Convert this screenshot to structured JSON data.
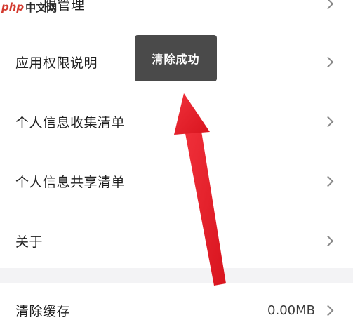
{
  "watermark": {
    "php": "php",
    "cn": "中文网"
  },
  "rows": [
    {
      "label": "限管理",
      "value": ""
    },
    {
      "label": "应用权限说明",
      "value": ""
    },
    {
      "label": "个人信息收集清单",
      "value": ""
    },
    {
      "label": "个人信息共享清单",
      "value": ""
    },
    {
      "label": "关于",
      "value": ""
    }
  ],
  "cache_row": {
    "label": "清除缓存",
    "value": "0.00MB"
  },
  "toast": {
    "text": "清除成功"
  },
  "colors": {
    "toast_bg": "#4a4a4a",
    "arrow": "#e8212b",
    "section_gap": "#f3f3f5"
  },
  "icons": {
    "chevron": "chevron-right-icon",
    "arrow": "red-annotation-arrow"
  }
}
